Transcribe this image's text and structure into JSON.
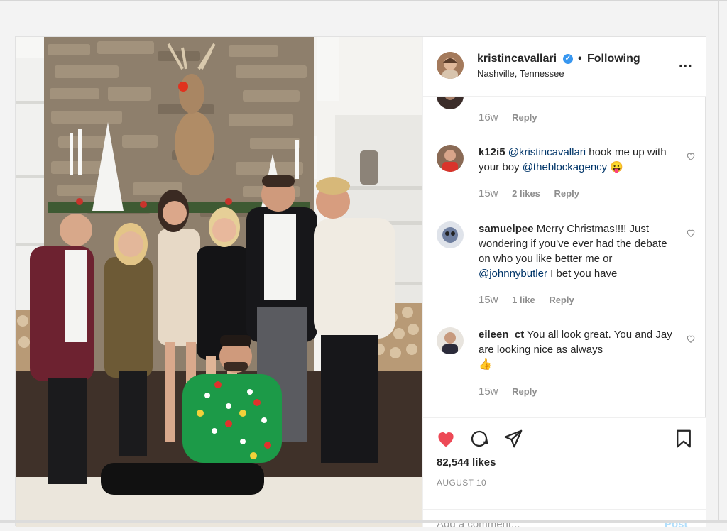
{
  "header": {
    "username": "kristincavallari",
    "separator": "•",
    "follow_status": "Following",
    "location": "Nashville, Tennessee",
    "more_label": "..."
  },
  "comments": [
    {
      "user": "",
      "text": "",
      "time": "16w",
      "likes": "",
      "reply": "Reply"
    },
    {
      "user": "k12i5",
      "parts": [
        "@kristincavallari",
        " hook me up with your boy ",
        "@theblockagency",
        " 😛"
      ],
      "time": "15w",
      "likes": "2 likes",
      "reply": "Reply"
    },
    {
      "user": "samuelpee",
      "parts": [
        "Merry Christmas!!!! Just wondering if you've ever had the debate on who you like better me or ",
        "@johnnybutler",
        " I bet you have"
      ],
      "time": "15w",
      "likes": "1 like",
      "reply": "Reply"
    },
    {
      "user": "eileen_ct",
      "parts": [
        "You all look great. You and Jay are looking nice as always",
        "👍"
      ],
      "time": "15w",
      "likes": "",
      "reply": "Reply"
    }
  ],
  "actions": {
    "likes": "82,544 likes",
    "date": "AUGUST 10",
    "add_comment_placeholder": "Add a comment...",
    "post_label": "Post"
  },
  "colors": {
    "heart_liked": "#ed4956",
    "link": "#003569",
    "verified": "#3897f0"
  },
  "icons": [
    "heart-icon",
    "comment-icon",
    "share-icon",
    "bookmark-icon",
    "verified-badge-icon",
    "more-icon"
  ]
}
